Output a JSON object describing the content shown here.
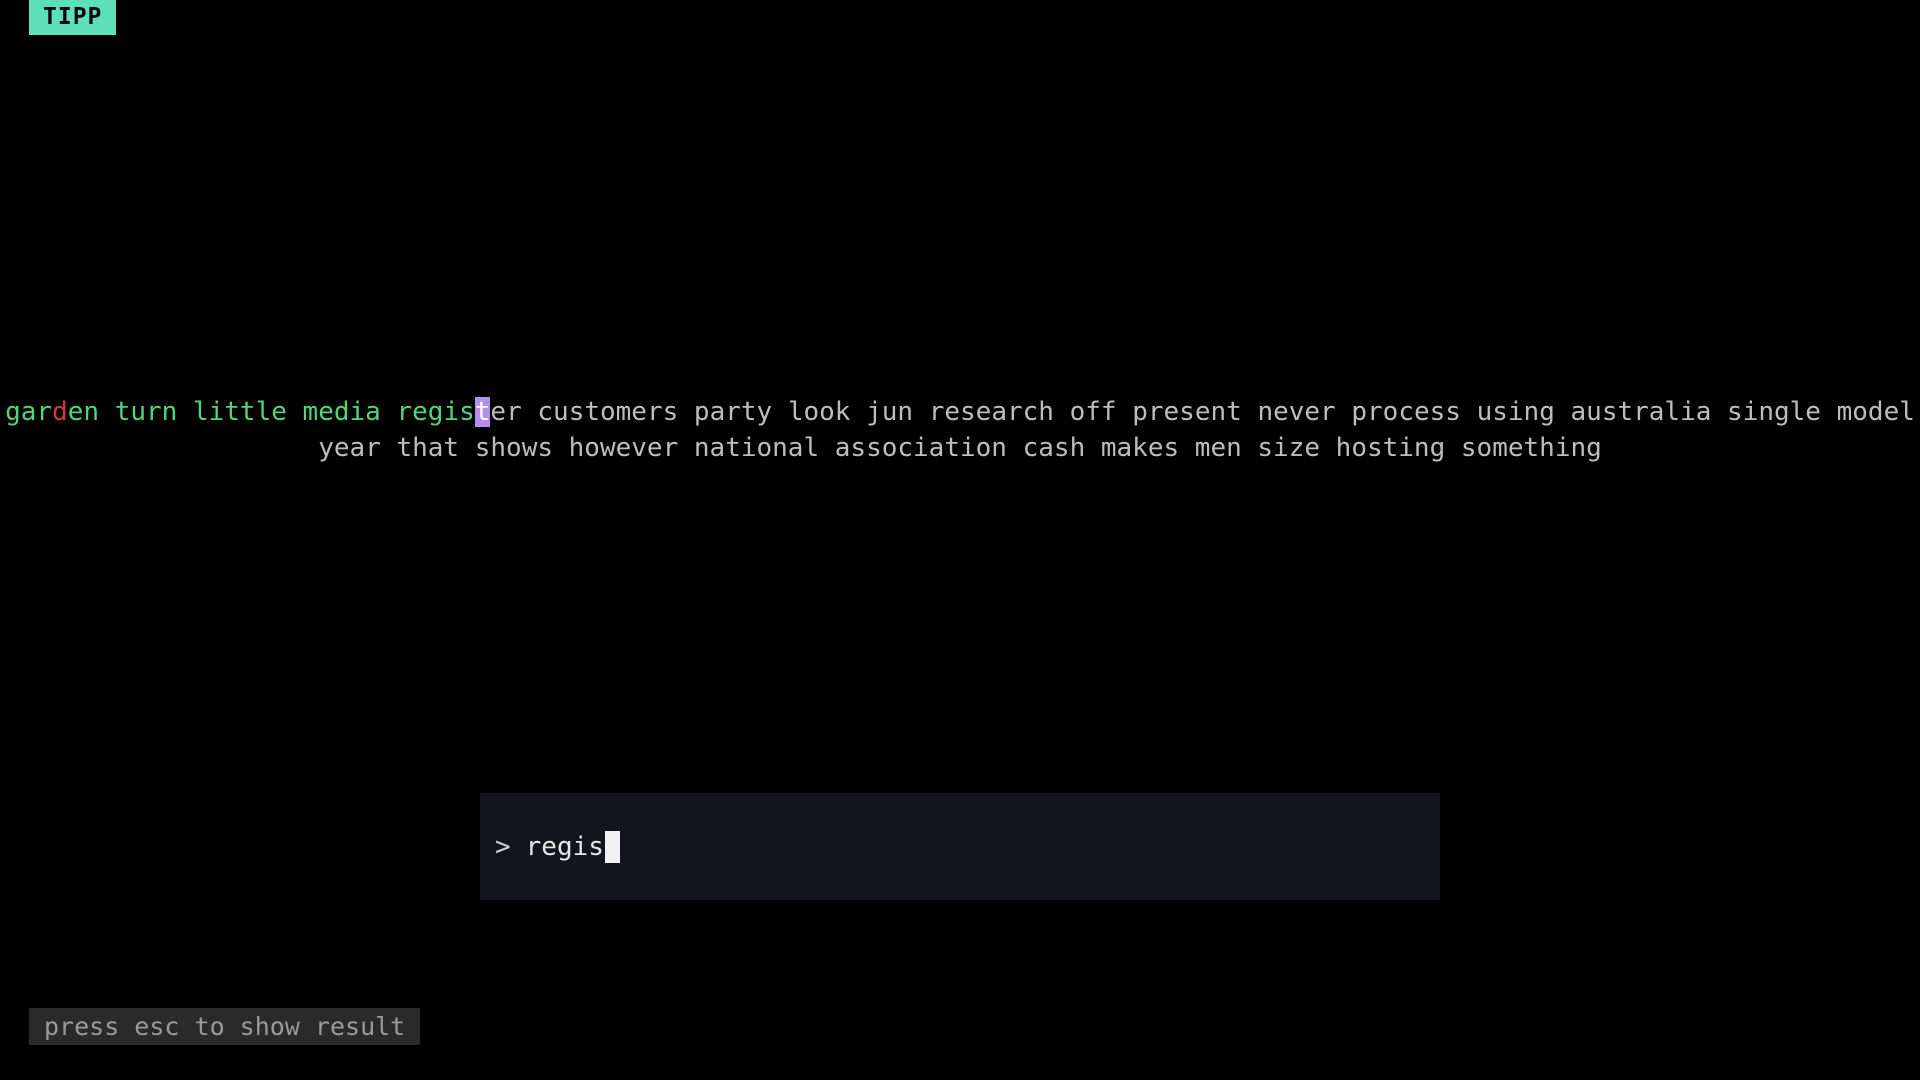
{
  "app": {
    "name": "TIPP"
  },
  "words": {
    "line1": {
      "w1_a": "gar",
      "w1_b": "d",
      "w1_c": "en",
      "w2": "turn",
      "w3": "little",
      "w4": "media",
      "w5_typed": "regis",
      "w5_cursor": "t",
      "w5_rest": "er",
      "rest": "customers party look jun research off present never process using australia single model"
    },
    "line2": "year that shows however national association cash makes men size hosting something"
  },
  "input": {
    "prompt": ">",
    "value": "regis"
  },
  "hint": {
    "text": "press esc to show result"
  },
  "colors": {
    "correct": "#4fd67a",
    "incorrect": "#d23a3a",
    "pending": "#bdbdbd",
    "cursor": "#b58cf0",
    "badge": "#5ee0b6"
  }
}
